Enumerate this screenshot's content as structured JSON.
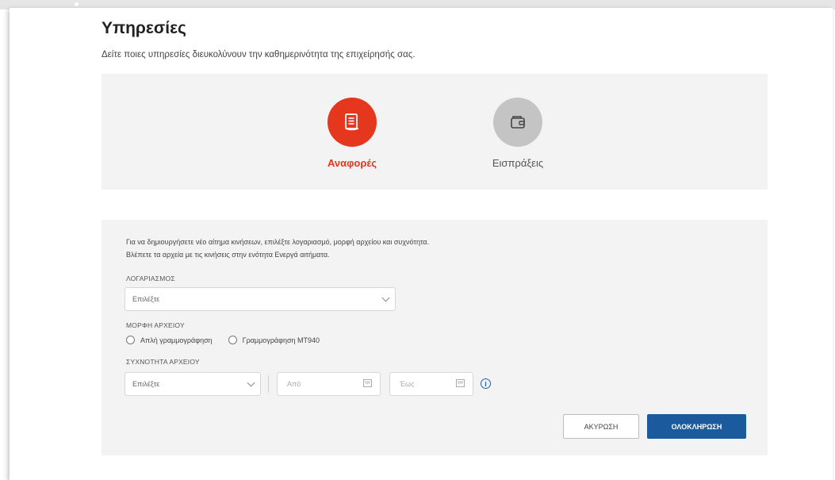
{
  "header": {
    "title": "Υπηρεσίες",
    "subtitle": "Δείτε ποιες υπηρεσίες διευκολύνουν την καθημερινότητα της επιχείρησής σας."
  },
  "services": [
    {
      "label": "Αναφορές",
      "icon": "document-icon",
      "active": true,
      "color": "#e5361e"
    },
    {
      "label": "Εισπράξεις",
      "icon": "wallet-icon",
      "active": false,
      "color": "#c4c4c4"
    }
  ],
  "form": {
    "intro_line1": "Για να δημιουργήσετε νέο αίτημα κινήσεων, επιλέξτε λογαριασμό, μορφή αρχείου και συχνότητα.",
    "intro_line2": "Βλέπετε τα αρχεία με τις κινήσεις στην ενότητα Ενεργά αιτήματα.",
    "account_label": "ΛΟΓΑΡΙΑΣΜΟΣ",
    "account_value": "Επιλέξτε",
    "format_label": "ΜΟΡΦΗ ΑΡΧΕΙΟΥ",
    "format_options": [
      "Απλή γραμμογράφηση",
      "Γραμμογράφηση MT940"
    ],
    "frequency_label": "ΣΥΧΝΟΤΗΤΑ ΑΡΧΕΙΟΥ",
    "frequency_value": "Επιλέξτε",
    "from_placeholder": "Από",
    "to_placeholder": "Έως",
    "info_glyph": "i",
    "cancel_label": "ΑΚΥΡΩΣΗ",
    "submit_label": "ΟΛΟΚΛΗΡΩΣΗ"
  },
  "colors": {
    "accent": "#e5361e",
    "primary_button": "#1c5a9e",
    "panel_bg": "#f3f3f3"
  }
}
